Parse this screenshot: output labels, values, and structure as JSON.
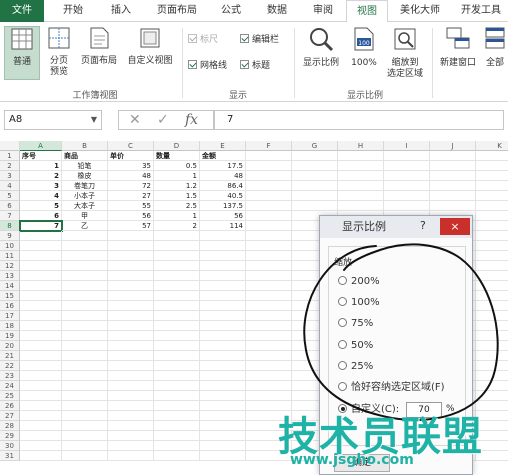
{
  "tabs": [
    "文件",
    "开始",
    "插入",
    "页面布局",
    "公式",
    "数据",
    "审阅",
    "视图",
    "美化大师",
    "开发工具"
  ],
  "ribbon": {
    "workbook_views": {
      "label": "工作簿视图",
      "normal": "普通",
      "page_break_line1": "分页",
      "page_break_line2": "预览",
      "page_layout": "页面布局",
      "custom_views": "自定义视图"
    },
    "show": {
      "label": "显示",
      "ruler": "标尺",
      "formula_bar": "编辑栏",
      "gridlines": "网格线",
      "headings": "标题"
    },
    "zoom": {
      "label": "显示比例",
      "zoom": "显示比例",
      "hundred": "100%",
      "to_selection_line1": "缩放到",
      "to_selection_line2": "选定区域"
    },
    "window": {
      "new_window": "新建窗口",
      "arrange_all": "全部"
    }
  },
  "formula_bar": {
    "name_box": "A8",
    "value": "7"
  },
  "sheet": {
    "columns": [
      "A",
      "B",
      "C",
      "D",
      "E",
      "F",
      "G",
      "H",
      "I",
      "J",
      "K"
    ],
    "row_numbers": [
      "1",
      "2",
      "3",
      "4",
      "5",
      "6",
      "7",
      "8",
      "9",
      "10",
      "11",
      "12",
      "13",
      "14",
      "15",
      "16",
      "17",
      "18",
      "19",
      "20",
      "21",
      "22",
      "23",
      "24",
      "25",
      "26",
      "27",
      "28",
      "29",
      "30",
      "31"
    ],
    "headers": [
      "序号",
      "商品",
      "单价",
      "数量",
      "金额"
    ],
    "rows": [
      [
        "1",
        "铅笔",
        "35",
        "0.5",
        "17.5"
      ],
      [
        "2",
        "橡皮",
        "48",
        "1",
        "48"
      ],
      [
        "3",
        "卷笔刀",
        "72",
        "1.2",
        "86.4"
      ],
      [
        "4",
        "小本子",
        "27",
        "1.5",
        "40.5"
      ],
      [
        "5",
        "大本子",
        "55",
        "2.5",
        "137.5"
      ],
      [
        "6",
        "甲",
        "56",
        "1",
        "56"
      ],
      [
        "7",
        "乙",
        "57",
        "2",
        "114"
      ]
    ]
  },
  "dialog": {
    "title": "显示比例",
    "help": "?",
    "close": "×",
    "group_label": "缩放",
    "options": [
      "200%",
      "100%",
      "75%",
      "50%",
      "25%",
      "恰好容纳选定区域(F)",
      "自定义(C):"
    ],
    "selected_index": 6,
    "custom_value": "70",
    "percent_sign": "%",
    "ok": "确定"
  },
  "watermark": {
    "text": "技术员联盟",
    "url": "www.jsgho.com"
  },
  "colors": {
    "accent": "#217346",
    "watermark": "#1fb2a6",
    "close": "#c9302c",
    "circle": "#111111"
  }
}
